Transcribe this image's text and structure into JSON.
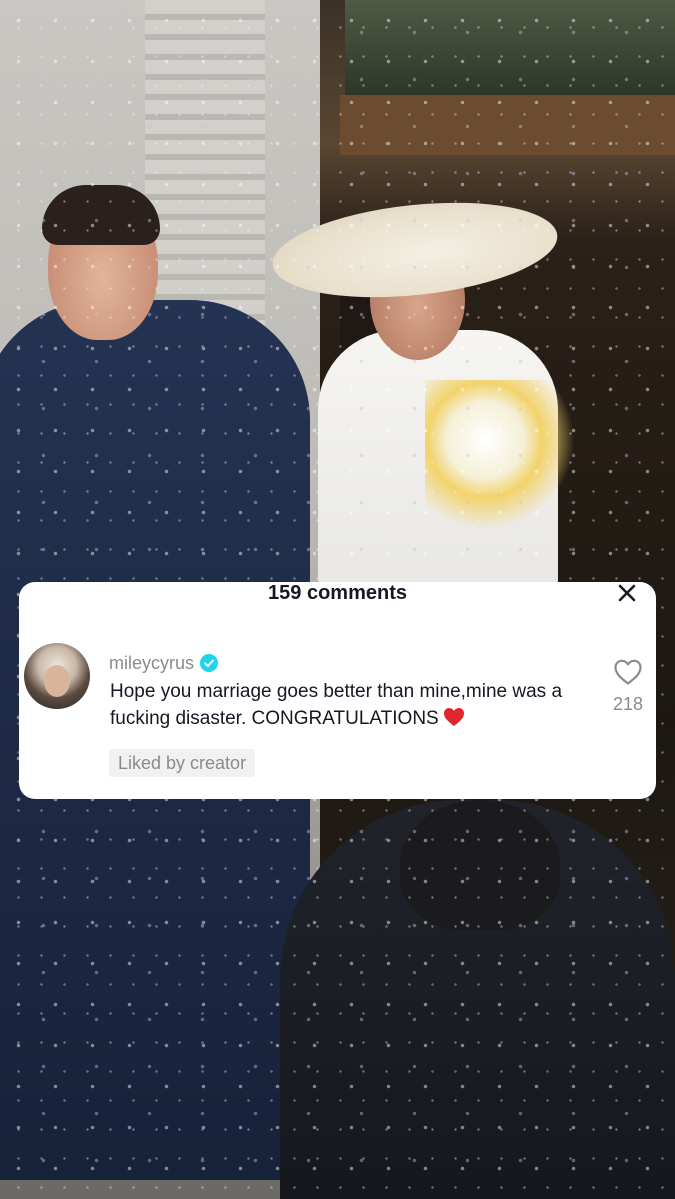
{
  "comments_panel": {
    "count_label": "159 comments",
    "close_icon": "close-icon"
  },
  "comment": {
    "username": "mileycyrus",
    "verified": true,
    "verified_icon": "verified-badge-icon",
    "text": "Hope you marriage goes better than mine,mine was a fucking disaster. CONGRATULATIONS",
    "emoji": "❤️",
    "liked_badge": "Liked by creator",
    "like_icon": "heart-outline-icon",
    "like_count": "218"
  },
  "colors": {
    "verified_blue": "#20d5ec",
    "text_primary": "#161823",
    "text_secondary": "#8a8b91",
    "heart_red": "#e0262d"
  }
}
